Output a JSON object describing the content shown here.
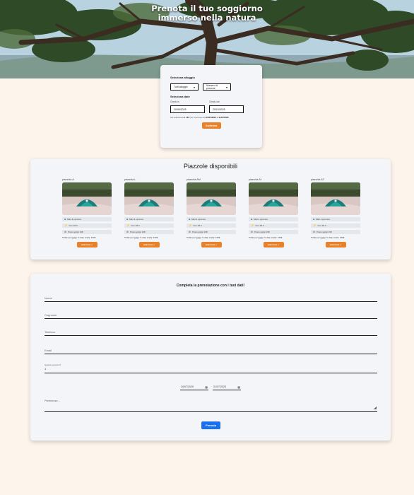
{
  "hero": {
    "title_line1": "Prenota il tuo soggiorno",
    "title_line2": "immerso nella natura"
  },
  "selection": {
    "accommodation_label": "Seleziona alloggio",
    "accommodation_value": "Tutti alloggio",
    "people_value": "Numero di persone",
    "dates_label": "Seleziona date",
    "checkin_label": "Check-in",
    "checkin_value": "20/09/2025",
    "checkout_label": "Check-out",
    "checkout_value": "20/10/2025",
    "note_prefix": "Hai selezionato",
    "note_nights": "1 LET",
    "note_mid": "per 8 persone dal",
    "note_from": "24/07/2025",
    "note_to_word": "al",
    "note_to": "31/07/2025",
    "confirm_label": "Conferma"
  },
  "pitches": {
    "title": "Piazzole disponibili",
    "items": [
      {
        "name": "piazzola-A",
        "people": "Max 4 persone",
        "power": "Con Wi-fi",
        "extra": "Posto gg/gp 40€",
        "total": "Totale per gg/gp: le date scelte: 160€",
        "button": "seleziona ✓"
      },
      {
        "name": "piazzola-L",
        "people": "Max 4 persone",
        "power": "Con Wi-fi",
        "extra": "Posto gg/gp 40€",
        "total": "Totale per gg/gp: le date scelte: 160€",
        "button": "seleziona ✓"
      },
      {
        "name": "piazzola-AM",
        "people": "Max 4 persone",
        "power": "Con Wi-fi",
        "extra": "Posto gg/gp 40€",
        "total": "Totale per gg/gp: le date scelte: 160€",
        "button": "seleziona ✓"
      },
      {
        "name": "piazzola-A1",
        "people": "Max 4 persone",
        "power": "Con Wi-fi",
        "extra": "Posto gg/gp 40€",
        "total": "Totale per gg/gp: le date scelte: 160€",
        "button": "seleziona ✓"
      },
      {
        "name": "piazzola-A2",
        "people": "Max 4 persone",
        "power": "Con Wi-fi",
        "extra": "Posto gg/gp 40€",
        "total": "Totale per gg/gp: le date scelte: 160€",
        "button": "seleziona ✓"
      }
    ]
  },
  "form": {
    "title": "Completa la prenotazione con i tuoi dati!",
    "name_placeholder": "Nome",
    "surname_placeholder": "Cognome",
    "phone_placeholder": "Telefono",
    "email_placeholder": "Email",
    "people_label": "Quante persone?",
    "people_value": "1",
    "date_from": "24/07/2025",
    "date_to": "31/07/2025",
    "preferences_placeholder": "Preferenze...",
    "submit_label": "Prenota"
  },
  "colors": {
    "accent_orange": "#e8822a",
    "submit_blue": "#1a6ef0",
    "page_bg": "#fdf5ec"
  }
}
